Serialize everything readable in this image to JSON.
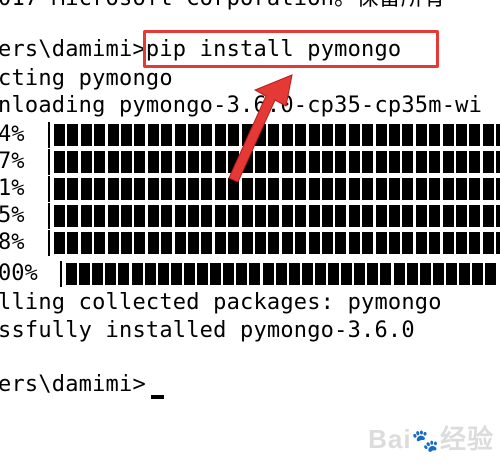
{
  "terminal": {
    "header_partial": "017 Microsoft Corporation。保留所有",
    "prompt_1": "ers\\damimi>",
    "command": "pip install pymongo",
    "line_collecting": "cting pymongo",
    "line_downloading": "nloading pymongo-3.6.0-cp35-cp35m-wi",
    "progress_lines": [
      "4%",
      "7%",
      "1%",
      "5%",
      "8%"
    ],
    "final_progress": "00%",
    "line_installing": "lling collected packages: pymongo",
    "line_success": "ssfully installed pymongo-3.6.0",
    "prompt_2": "ers\\damimi>"
  },
  "annotation": {
    "box_color": "#e53935",
    "arrow_color": "#e53935"
  },
  "watermark": {
    "text": "Bai",
    "suffix": "经验"
  }
}
